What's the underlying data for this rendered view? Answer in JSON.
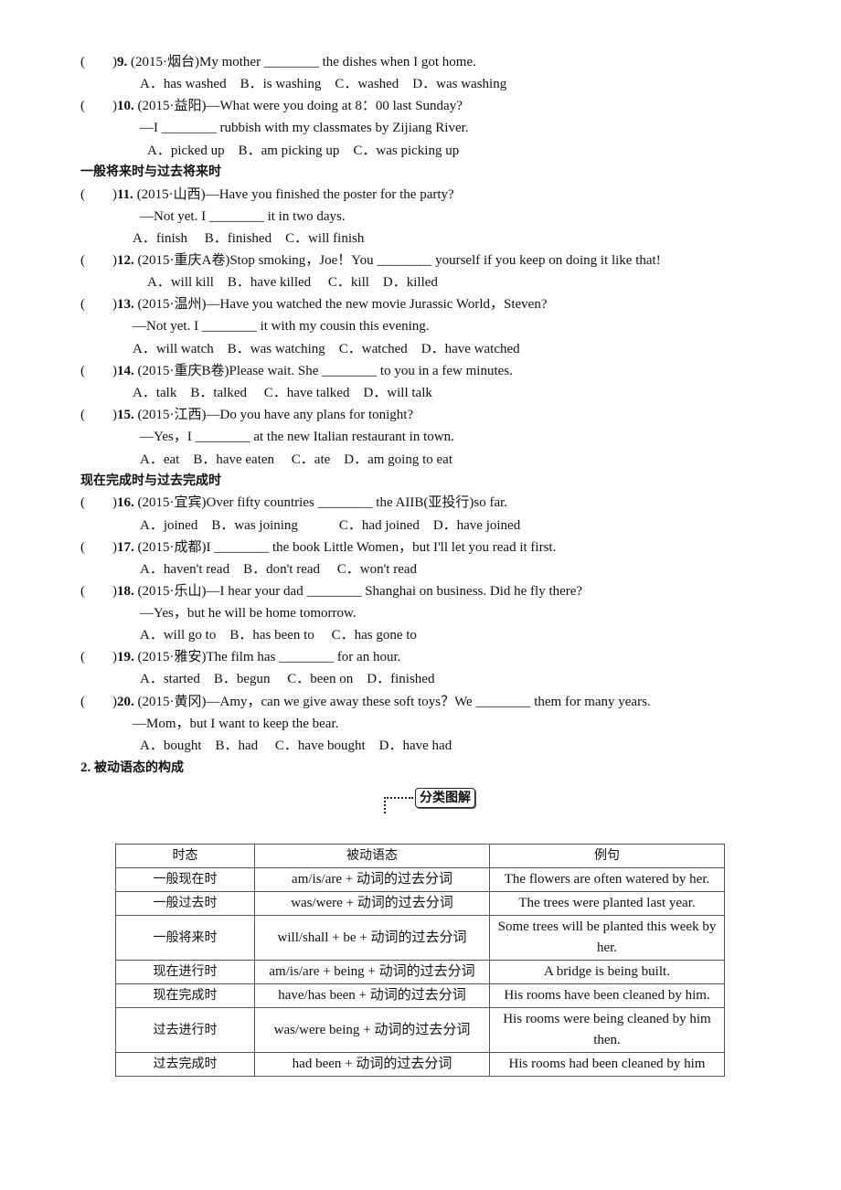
{
  "questions": [
    {
      "num": "9.",
      "source": "(2015·烟台)",
      "lines": [
        "My mother ________ the dishes when I got home."
      ],
      "options": "A．has washed　B．is washing　C．washed　D．was washing"
    },
    {
      "num": "10.",
      "source": "(2015·益阳)",
      "lines": [
        "—What were you doing at 8：00 last Sunday?",
        "—I ________ rubbish with my classmates by Zijiang River."
      ],
      "options": "A．picked up　B．am picking up　C．was picking up"
    },
    {
      "num": "11.",
      "source": "(2015·山西)",
      "lines": [
        "—Have you finished the poster for the party?",
        "—Not yet. I ________ it in two days."
      ],
      "options": "A．finish　 B．finished　C．will finish"
    },
    {
      "num": "12.",
      "source": "(2015·重庆A卷)",
      "lines": [
        "Stop smoking，Joe！You ________ yourself if you keep on doing it like that!"
      ],
      "options": "A．will kill　B．have killed　 C．kill　D．killed"
    },
    {
      "num": "13.",
      "source": "(2015·温州)",
      "lines": [
        "—Have you watched the new movie Jurassic World，Steven?",
        "—Not yet. I ________ it with my cousin this evening."
      ],
      "options": "A．will watch　B．was watching　C．watched　D．have watched"
    },
    {
      "num": "14.",
      "source": "(2015·重庆B卷)",
      "lines": [
        "Please wait. She ________ to you in a few minutes."
      ],
      "options": "A．talk　B．talked　 C．have talked　D．will talk"
    },
    {
      "num": "15.",
      "source": "(2015·江西)",
      "lines": [
        "—Do you have any plans for tonight?",
        "—Yes，I ________ at the new Italian restaurant in town."
      ],
      "options": "A．eat　B．have eaten　 C．ate　D．am going to eat"
    },
    {
      "num": "16.",
      "source": "(2015·宜宾)",
      "lines": [
        "Over fifty countries ________ the AIIB(亚投行)so far."
      ],
      "options": "A．joined　B．was joining　　　C．had joined　D．have joined"
    },
    {
      "num": "17.",
      "source": "(2015·成都)",
      "lines": [
        "I ________ the book Little Women，but I'll let you read it first."
      ],
      "options": "A．haven't read　B．don't read　 C．won't read"
    },
    {
      "num": "18.",
      "source": "(2015·乐山)",
      "lines": [
        "—I hear your dad ________ Shanghai on business. Did he fly there?",
        "—Yes，but he will be home tomorrow."
      ],
      "options": "A．will go to　B．has been to　 C．has gone to"
    },
    {
      "num": "19.",
      "source": "(2015·雅安)",
      "lines": [
        "The film has ________ for an hour."
      ],
      "options": "A．started　B．begun　 C．been on　D．finished"
    },
    {
      "num": "20.",
      "source": "(2015·黄冈)",
      "lines": [
        "—Amy，can we give away these soft toys？We ________ them for many years.",
        "—Mom，but I want to keep the bear."
      ],
      "options": "A．bought　B．had　 C．have bought　D．have had"
    }
  ],
  "headings": {
    "future": "一般将来时与过去将来时",
    "perfect": "现在完成时与过去完成时",
    "passive_num": "2.",
    "passive": "被动语态的构成"
  },
  "badge": "分类图解",
  "table": {
    "headers": [
      "时态",
      "被动语态",
      "例句"
    ],
    "rows": [
      [
        "一般现在时",
        "am/is/are + 动词的过去分词",
        "The flowers are often watered by her."
      ],
      [
        "一般过去时",
        "was/were + 动词的过去分词",
        "The trees were planted last year."
      ],
      [
        "一般将来时",
        "will/shall + be + 动词的过去分词",
        "Some trees will be planted this week by her."
      ],
      [
        "现在进行时",
        "am/is/are + being + 动词的过去分词",
        "A bridge is being built."
      ],
      [
        "现在完成时",
        "have/has been + 动词的过去分词",
        "His rooms have been cleaned by him."
      ],
      [
        "过去进行时",
        "was/were being + 动词的过去分词",
        "His rooms were being cleaned by him then."
      ],
      [
        "过去完成时",
        "had been + 动词的过去分词",
        "His rooms had been cleaned by him"
      ]
    ]
  }
}
